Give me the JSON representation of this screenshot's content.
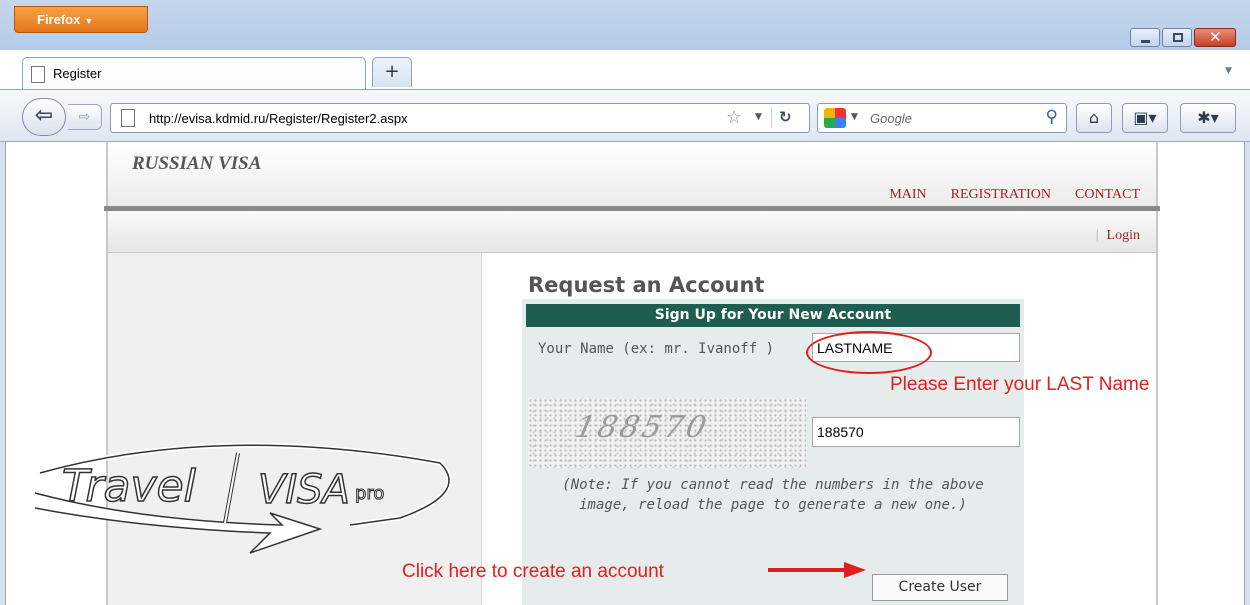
{
  "browser": {
    "menu_label": "Firefox",
    "tab_title": "Register",
    "new_tab_label": "+",
    "url": "http://evisa.kdmid.ru/Register/Register2.aspx",
    "search_placeholder": "Google"
  },
  "site": {
    "logo": "RUSSIAN VISA",
    "nav": [
      "MAIN",
      "REGISTRATION",
      "CONTACT"
    ],
    "login_separator": "|",
    "login": "Login"
  },
  "form": {
    "title": "Request an Account",
    "header": "Sign Up for Your New Account",
    "name_label": "Your Name (ex: mr. Ivanoff )",
    "name_value": "LASTNAME",
    "captcha_image_text": "188570",
    "captcha_value": "188570",
    "note_line1": "(Note: If you cannot read the numbers in the above",
    "note_line2": "image, reload the page to generate a new one.)",
    "create_button": "Create User"
  },
  "annotations": {
    "lastname_hint": "Please Enter your LAST Name",
    "create_hint": "Click here to create an account",
    "color": "#e21e1e"
  },
  "watermark": {
    "word1": "Travel",
    "word2": "VISA",
    "word3": "pro"
  }
}
